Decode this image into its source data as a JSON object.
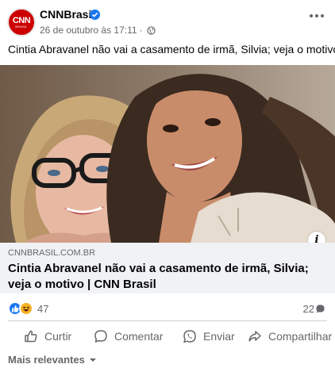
{
  "post": {
    "page_name": "CNNBrasil",
    "avatar_text": "CNN",
    "avatar_subtext": "BRASIL",
    "timestamp": "26 de outubro às 17:11",
    "separator": "·",
    "text": "Cintia Abravanel não vai a casamento de irmã, Silvia; veja o motivo",
    "info_label": "i"
  },
  "link_preview": {
    "domain": "CNNBRASIL.COM.BR",
    "title": "Cintia Abravanel não vai a casamento de irmã, Silvia; veja o motivo | CNN Brasil"
  },
  "stats": {
    "reactions_count": "47",
    "comments_count": "22"
  },
  "actions": {
    "like": "Curtir",
    "comment": "Comentar",
    "send": "Enviar",
    "share": "Compartilhar"
  },
  "comments_sort": {
    "label": "Mais relevantes"
  },
  "colors": {
    "brand_blue": "#1877f2",
    "cnn_red": "#cc0000",
    "secondary_text": "#65676b",
    "link_background": "#f0f2f5"
  },
  "icons": [
    "verified-badge-icon",
    "globe-icon",
    "more-options-icon",
    "info-icon",
    "like-reaction-icon",
    "haha-reaction-icon",
    "comment-bubble-icon",
    "thumbs-up-icon",
    "comment-icon",
    "whatsapp-icon",
    "share-icon",
    "chevron-down-icon"
  ]
}
